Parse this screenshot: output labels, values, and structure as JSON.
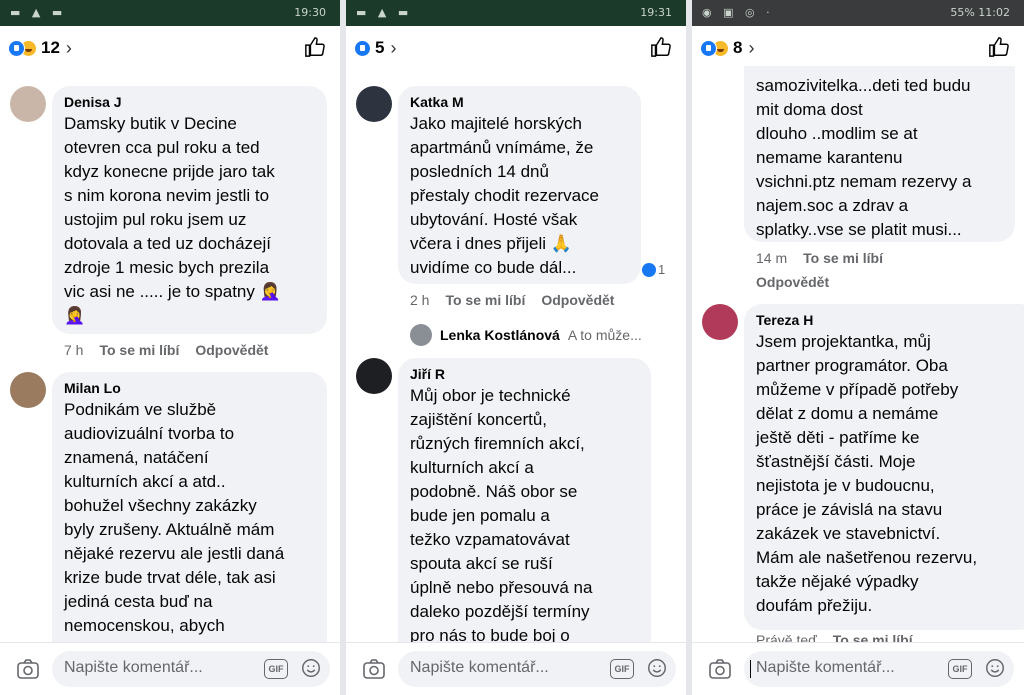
{
  "colors": {
    "accent": "#1877f2",
    "bubble": "#f0f2f5",
    "muted": "#65676b"
  },
  "panels": [
    {
      "status_time": "19:30",
      "reaction_count": "12",
      "comments": [
        {
          "name": "Denisa J",
          "text": "Damsky butik v Decine\notevren cca pul roku a ted\nkdyz konecne prijde jaro tak\ns nim korona nevim jestli to\nustojim pul roku jsem uz\ndotovala a ted uz docházejí\nzdroje 1 mesic bych prezila\nvic asi ne ..... je to spatny 🤦‍♀️\n🤦‍♀️",
          "time": "7 h",
          "like": "To se mi líbí",
          "reply": "Odpovědět"
        },
        {
          "name": "Milan Lo",
          "text": "Podnikám ve službě\naudiovizuální tvorba to\nznamená, natáčení\nkulturních akcí a atd..\nbohužel všechny zakázky\nbyly zrušeny. Aktuálně mám\nnějaké rezervu ale jestli daná\nkrize bude trvat déle, tak asi\njediná cesta buď na\nnemocenskou, abych"
        }
      ],
      "composer": {
        "placeholder": "Napište komentář...",
        "gif": "GIF"
      }
    },
    {
      "status_time": "19:31",
      "reaction_count": "5",
      "comments": [
        {
          "name": "Katka M",
          "text": "Jako majitelé horských\napartmánů vnímáme, že\nposledních 14 dnů\npřestaly chodit rezervace\nubytování. Hosté však\nvčera i dnes přijeli 🙏\nuvidíme co bude dál...",
          "time": "2 h",
          "like": "To se mi líbí",
          "reply": "Odpovědět",
          "like_count": "1"
        },
        {
          "name": "Jiří R",
          "text": "Můj obor je technické\nzajištění koncertů,\nrůzných firemních akcí,\nkulturních akcí a\npodobně. Náš obor se\nbude jen pomalu a\ntežko vzpamatovávat\nspouta akcí se ruší\núplně nebo přesouvá na\ndaleko pozdější termíny\npro nás to bude boj o"
        }
      ],
      "reply_preview": {
        "name": "Lenka Kostlánová",
        "text": "A to může..."
      },
      "composer": {
        "placeholder": "Napište komentář...",
        "gif": "GIF"
      }
    },
    {
      "status_time": "11:02",
      "battery": "55%",
      "reaction_count": "8",
      "comments": [
        {
          "text": "samozivitelka...deti ted budu\nmit doma dost\ndlouho ..modlim se at\nnemame karantenu\nvsichni.ptz nemam rezervy a\nnajem.soc a zdrav a\nsplatky..vse se platit musi...",
          "time": "14 m",
          "like": "To se mi líbí",
          "reply": "Odpovědět"
        },
        {
          "name": "Tereza H",
          "text": "Jsem projektantka, můj\npartner programátor. Oba\nmůžeme v případě potřeby\ndělat z domu a nemáme\nještě děti - patříme ke\nšťastnější části. Moje\nnejistota je v budoucnu,\npráce je závislá na stavu\nzakázek ve stavebnictví.\nMám ale našetřenou rezervu,\ntakže nějaké výpadky\ndoufám přežiju.",
          "time": "Právě teď",
          "like": "To se mi líbí"
        }
      ],
      "composer": {
        "placeholder": "Napište komentář...",
        "gif": "GIF"
      }
    }
  ]
}
